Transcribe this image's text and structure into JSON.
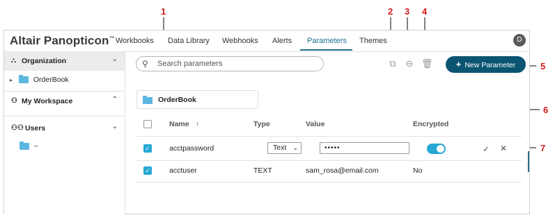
{
  "app": {
    "brand": "Altair Panopticon",
    "brand_mark": "™",
    "nav_tabs": [
      {
        "label": "Workbooks"
      },
      {
        "label": "Data Library"
      },
      {
        "label": "Webhooks"
      },
      {
        "label": "Alerts"
      },
      {
        "label": "Parameters"
      },
      {
        "label": "Themes"
      }
    ],
    "active_tab": "Parameters",
    "avatar_initial": "D"
  },
  "sidebar": {
    "organization": {
      "label": "Organization",
      "child": "OrderBook"
    },
    "my_workspace": {
      "label": "My Workspace"
    },
    "users": {
      "label": "Users",
      "child": "~"
    }
  },
  "toolbar": {
    "search_placeholder": "Search parameters",
    "copy_icon": "copy-icon",
    "move_icon": "arrow-right-circle-icon",
    "delete_icon": "trash-icon",
    "new_button_label": "New Parameter"
  },
  "breadcrumb": {
    "folder": "OrderBook"
  },
  "table": {
    "columns": {
      "name": "Name",
      "type": "Type",
      "value": "Value",
      "encrypted": "Encrypted"
    },
    "rows": [
      {
        "name": "acctpassword",
        "type": "Text",
        "value": "•••••",
        "encrypted": true,
        "editing": true
      },
      {
        "name": "acctuser",
        "type": "TEXT",
        "value": "sam_rosa@email.com",
        "encrypted": "No",
        "editing": false
      }
    ]
  },
  "callouts": [
    "1",
    "2",
    "3",
    "4",
    "5",
    "6",
    "7"
  ],
  "colors": {
    "accent": "#0b5572",
    "toggle": "#27a8d4",
    "callout": "#d11a1a",
    "active_tab": "#1f6f8b"
  }
}
